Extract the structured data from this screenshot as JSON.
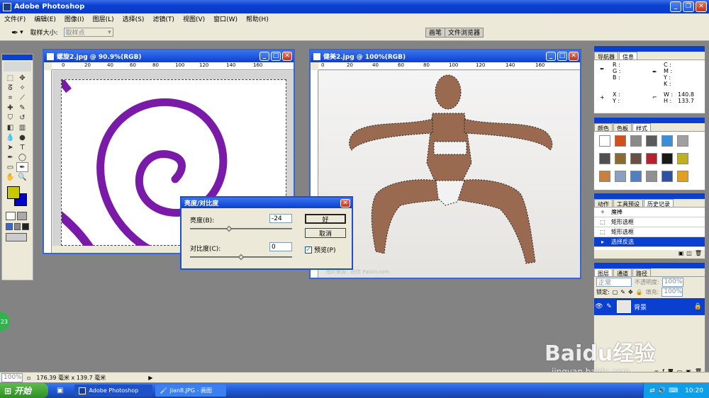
{
  "app": {
    "title": "Adobe Photoshop"
  },
  "menu": [
    "文件(F)",
    "编辑(E)",
    "图像(I)",
    "图层(L)",
    "选择(S)",
    "滤镜(T)",
    "视图(V)",
    "窗口(W)",
    "帮助(H)"
  ],
  "options": {
    "sample_size_label": "取样大小:",
    "sample_size_value": "取样点",
    "tab_brushes": "画笔",
    "tab_file_browser": "文件浏览器"
  },
  "doc1": {
    "title": "螺旋2.jpg @ 90.9%(RGB)",
    "ruler": [
      "0",
      "20",
      "40",
      "60",
      "80",
      "100",
      "120",
      "140",
      "160"
    ]
  },
  "doc2": {
    "title": "健美2.jpg @ 100%(RGB)",
    "ruler": [
      "0",
      "20",
      "40",
      "60",
      "80",
      "100",
      "120",
      "140",
      "160"
    ],
    "watermark": "图片来源：拍信 Paixin.com"
  },
  "dialog": {
    "title": "亮度/对比度",
    "brightness_label": "亮度(B):",
    "brightness_value": "-24",
    "contrast_label": "对比度(C):",
    "contrast_value": "0",
    "ok": "好",
    "cancel": "取消",
    "preview": "预览(P)",
    "brightness_level": -24,
    "contrast_level": 0
  },
  "navigator": {
    "tab_nav": "导航器",
    "tab_info": "信息",
    "r": "R :",
    "g": "G :",
    "b": "B :",
    "c": "C :",
    "m": "M :",
    "y": "Y :",
    "k": "K :",
    "x": "X :",
    "yy": "Y :",
    "w": "W :",
    "h": "H :",
    "w_value": "140.8",
    "h_value": "133.7"
  },
  "swatches": {
    "tab_color": "颜色",
    "tab_swatches": "色板",
    "tab_styles": "样式",
    "colors": [
      "#ffffff",
      "#d4501a",
      "#8a8a8a",
      "#5a5a5a",
      "#3a8fd8",
      "#a0a0a0",
      "#505050",
      "#8a6a30",
      "#6a5040",
      "#b82030",
      "#1a1a1a",
      "#c0b020",
      "#c88040",
      "#8aa0c0",
      "#5080c0",
      "#909090",
      "#3050a0",
      "#e0a020"
    ]
  },
  "history": {
    "tab_actions": "动作",
    "tab_presets": "工具预设",
    "tab_history": "历史记录",
    "items": [
      "魔棒",
      "矩形选框",
      "矩形选框",
      "选择反选"
    ]
  },
  "layers": {
    "tab_layers": "图层",
    "tab_channels": "通道",
    "tab_paths": "路径",
    "blend": "正常",
    "opacity_label": "不透明度:",
    "opacity": "100%",
    "lock_label": "锁定:",
    "fill_label": "填充:",
    "fill": "100%",
    "layer_name": "背景"
  },
  "status": {
    "zoom": "100%",
    "size": "176.39 毫米 x 139.7 毫米"
  },
  "taskbar": {
    "start": "开始",
    "task1": "Adobe Photoshop",
    "task2": "jian8.JPG - 画图",
    "clock": "10:20"
  },
  "overlay": {
    "baidu": "Baidu经验",
    "url": "jingyan.baidu.com",
    "badge": "23"
  }
}
